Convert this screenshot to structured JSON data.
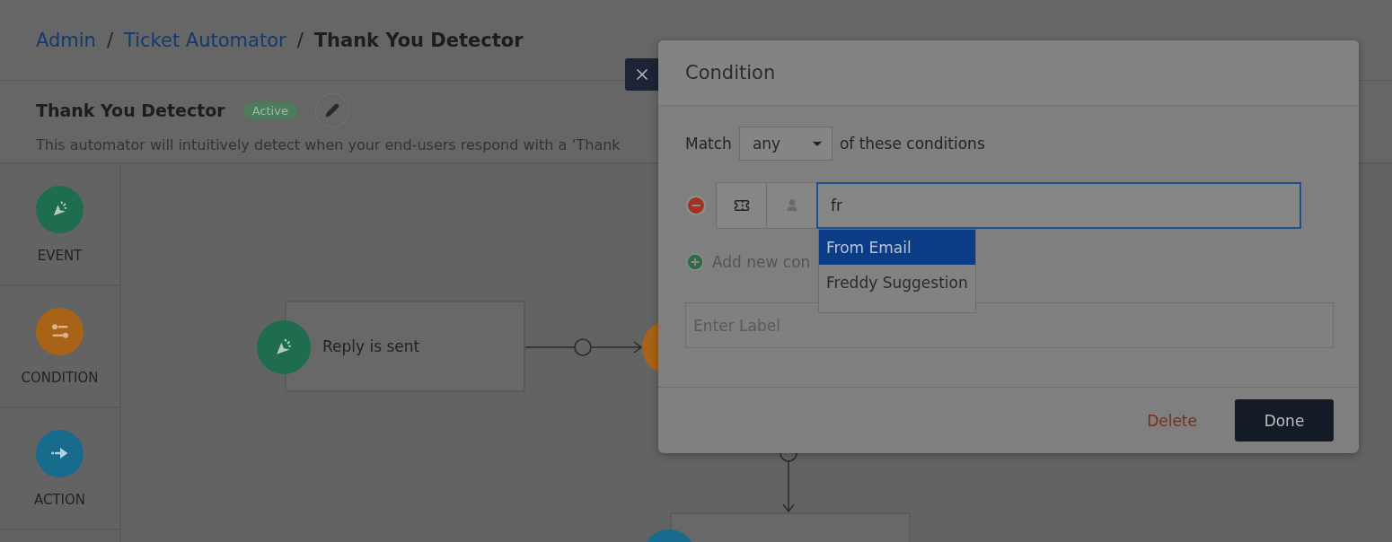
{
  "breadcrumb": [
    {
      "label": "Admin",
      "kind": "link",
      "separator": "/"
    },
    {
      "label": "Ticket Automator",
      "kind": "link",
      "separator": "/"
    },
    {
      "label": "Thank You Detector",
      "kind": "current"
    }
  ],
  "automator": {
    "title": "Thank You Detector",
    "status": "Active",
    "description": "This automator will intuitively detect when your end-users respond with a ‘Thank"
  },
  "palette": [
    {
      "label": "EVENT",
      "kind": "event"
    },
    {
      "label": "CONDITION",
      "kind": "condition"
    },
    {
      "label": "ACTION",
      "kind": "action"
    }
  ],
  "canvas": {
    "nodes": [
      {
        "label": "Reply is sent",
        "kind": "event"
      },
      {
        "kind": "condition"
      },
      {
        "kind": "action"
      }
    ]
  },
  "modal": {
    "title": "Condition",
    "match": {
      "prefix": "Match",
      "value": "any",
      "suffix": "of these conditions"
    },
    "condition": {
      "value": "fr",
      "suggestions": [
        {
          "label": "From Email",
          "selected": true
        },
        {
          "label": "Freddy Suggestion",
          "selected": false
        }
      ]
    },
    "add_label": "Add new con",
    "label_field": {
      "placeholder": "Enter Label"
    },
    "buttons": [
      {
        "label": "Delete",
        "kind": "danger"
      },
      {
        "label": "Done",
        "kind": "primary"
      }
    ]
  }
}
